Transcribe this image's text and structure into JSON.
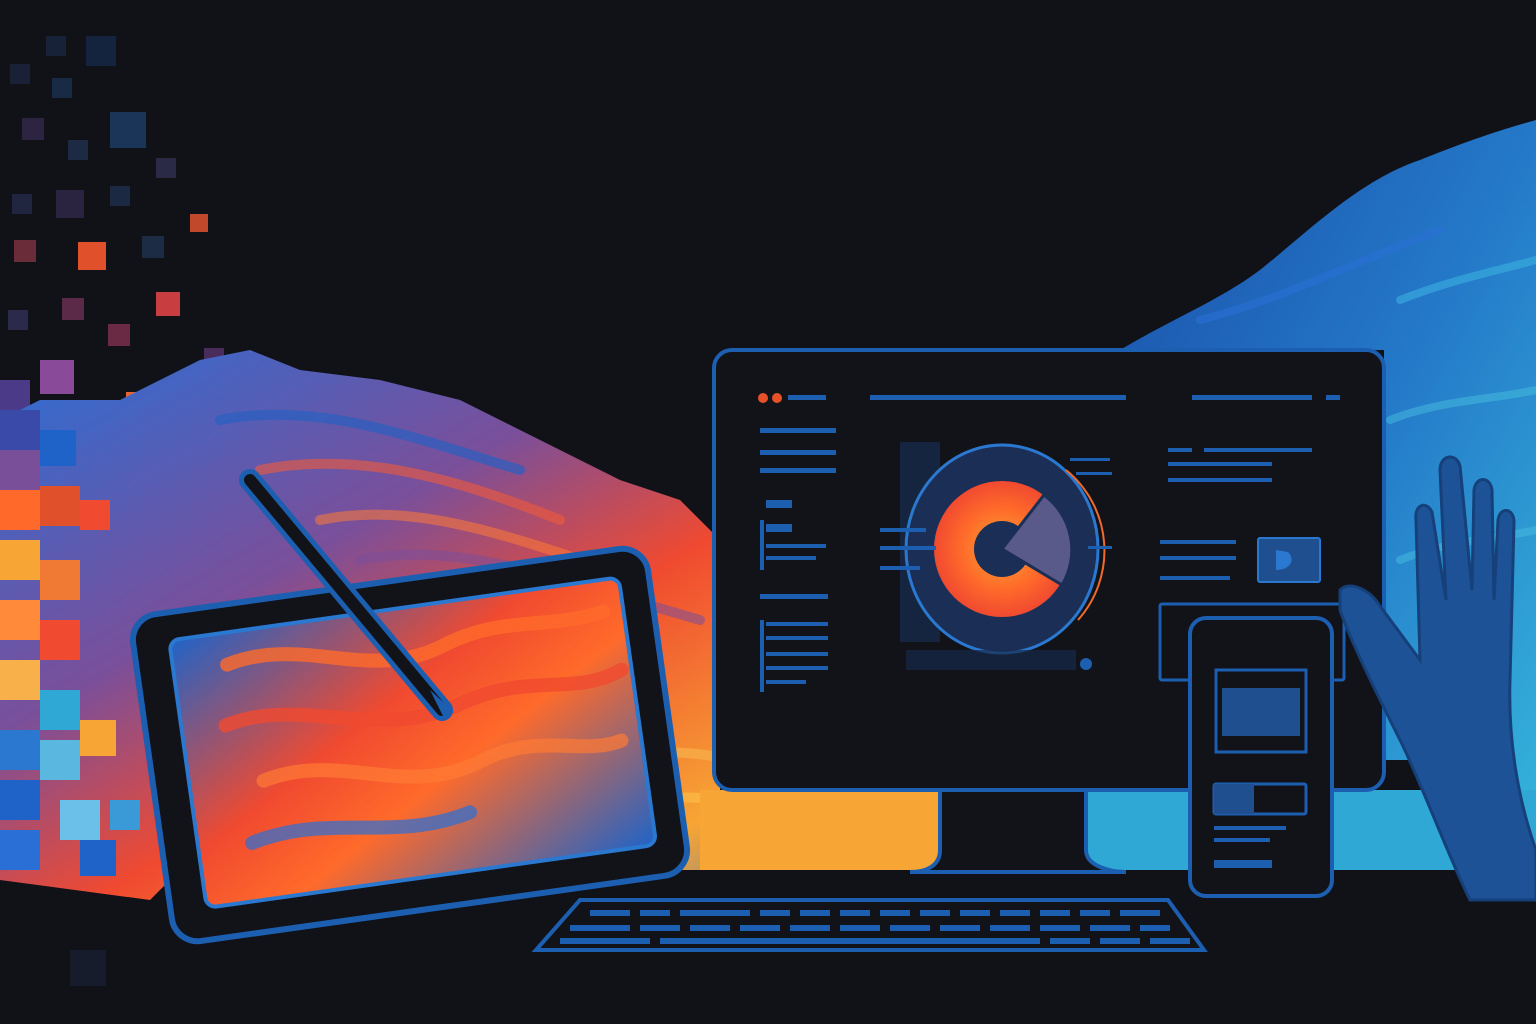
{
  "palette": {
    "background": "#111118",
    "outline": "#1c5fb0",
    "outline_bright": "#2a78d0",
    "screen": "#121219",
    "orange": "#ff6a2a",
    "red_orange": "#f04a30",
    "amber": "#f7a534",
    "blue": "#1f63c8",
    "cyan": "#2fa8d6",
    "violet": "#7a4f9a",
    "hand": "#1d5396"
  },
  "icons": [
    "tablet-icon",
    "stylus-icon",
    "monitor-icon",
    "keyboard-icon",
    "smartphone-icon",
    "hand-icon",
    "pie-chart-icon"
  ]
}
